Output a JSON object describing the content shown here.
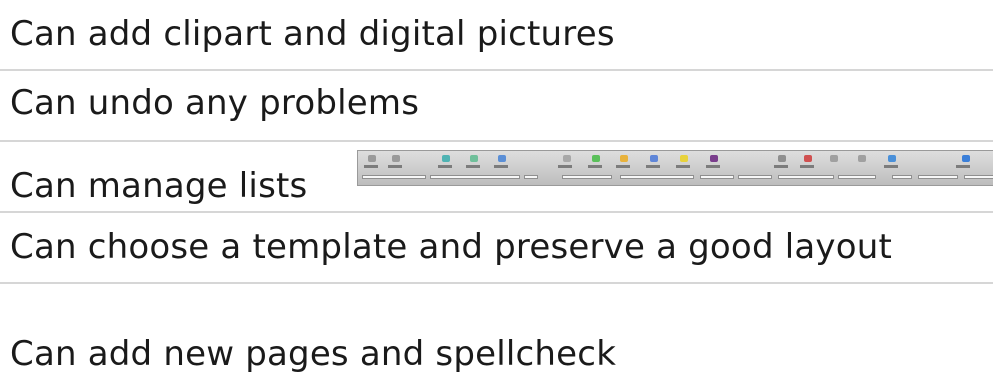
{
  "items": [
    {
      "label": "Can add clipart and digital pictures"
    },
    {
      "label": "Can undo any problems"
    },
    {
      "label": "Can manage lists"
    },
    {
      "label": "Can choose a template and preserve a good layout"
    },
    {
      "label": "Can add new pages and spellcheck"
    }
  ],
  "toolbar_image": {
    "icons": [
      "gray",
      "gray",
      "teal",
      "teal",
      "blue",
      "gray",
      "green",
      "orange",
      "blue",
      "yellow",
      "purple",
      "gray",
      "red",
      "gray",
      "gray",
      "blue",
      "blue"
    ]
  },
  "colors": {
    "text": "#1a1a1a",
    "divider": "#d6d6d6",
    "background": "#ffffff"
  }
}
